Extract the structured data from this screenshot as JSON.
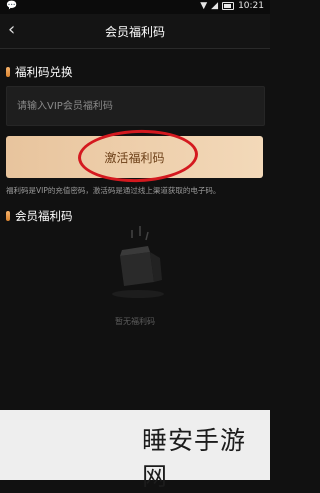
{
  "status_bar": {
    "left_icon": "wechat-icon",
    "time": "10:21"
  },
  "header": {
    "back_icon": "chevron-left-icon",
    "title": "会员福利码"
  },
  "redeem_section": {
    "title": "福利码兑换",
    "input_placeholder": "请输入VIP会员福利码"
  },
  "activate_button": {
    "label": "激活福利码"
  },
  "hint": "福利码是VIP的充值密码，激活码是通过线上渠道获取的电子码。",
  "member_section": {
    "title": "会员福利码",
    "empty_text": "暂无福利码"
  },
  "watermark": "睡安手游网",
  "colors": {
    "accent": "#f0cfa8",
    "button_text": "#6b3e16",
    "highlight_ring": "#d4191f",
    "background": "#111111"
  }
}
